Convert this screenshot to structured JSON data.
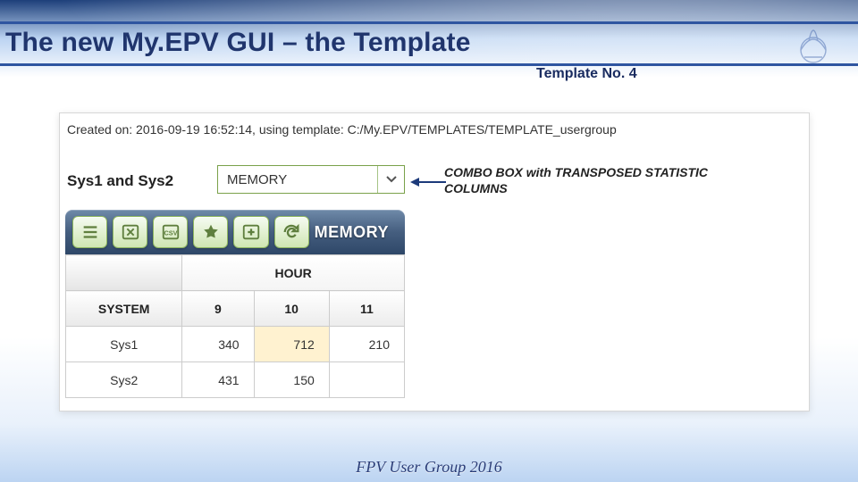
{
  "header": {
    "title": "The new My.EPV GUI – the Template",
    "subtitle": "Template No. 4"
  },
  "created": "Created on: 2016-09-19 16:52:14, using template: C:/My.EPV/TEMPLATES/TEMPLATE_usergroup",
  "row_title": "Sys1 and Sys2",
  "combo": {
    "value": "MEMORY"
  },
  "annotation": {
    "line1": "COMBO BOX with TRANSPOSED STATISTIC",
    "line2": "COLUMNS"
  },
  "toolbar": {
    "title": "MEMORY",
    "icons": [
      "menu-icon",
      "excel-icon",
      "csv-icon",
      "star-icon",
      "add-icon",
      "refresh-icon"
    ]
  },
  "table": {
    "group_header": "HOUR",
    "row_header": "SYSTEM",
    "columns": [
      "9",
      "10",
      "11"
    ],
    "rows": [
      {
        "name": "Sys1",
        "values": [
          "340",
          "712",
          "210"
        ],
        "highlight": 1
      },
      {
        "name": "Sys2",
        "values": [
          "431",
          "150",
          ""
        ],
        "highlight": -1
      }
    ]
  },
  "chart_data": {
    "type": "table",
    "title": "MEMORY",
    "xlabel": "HOUR",
    "ylabel": "SYSTEM",
    "categories": [
      "9",
      "10",
      "11"
    ],
    "series": [
      {
        "name": "Sys1",
        "values": [
          340,
          712,
          210
        ]
      },
      {
        "name": "Sys2",
        "values": [
          431,
          150,
          null
        ]
      }
    ]
  },
  "footer": "FPV User Group 2016"
}
